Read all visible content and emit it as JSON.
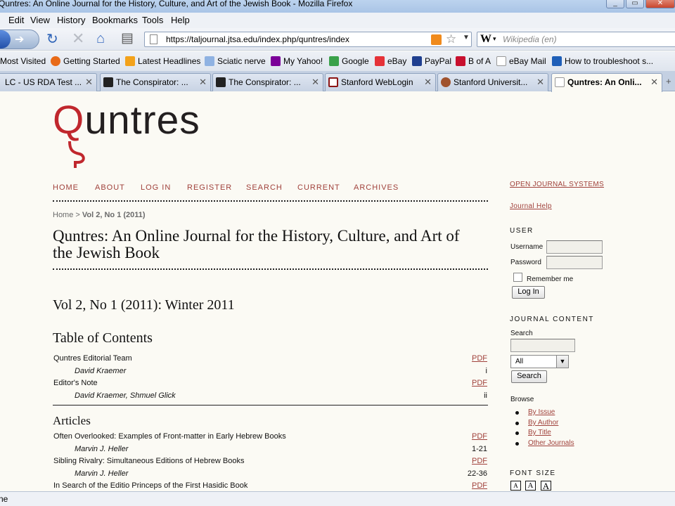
{
  "window": {
    "title": "Quntres: An Online Journal for the History, Culture, and Art of the Jewish Book - Mozilla Firefox"
  },
  "menu": [
    "Edit",
    "View",
    "History",
    "Bookmarks",
    "Tools",
    "Help"
  ],
  "nav": {
    "url": "https://taljournal.jtsa.edu/index.php/quntres/index",
    "search_placeholder": "Wikipedia (en)",
    "search_engine_icon": "W"
  },
  "bookmarks": [
    "Most Visited",
    "Getting Started",
    "Latest Headlines",
    "Sciatic nerve",
    "My Yahoo!",
    "Google",
    "eBay",
    "PayPal",
    "B of A",
    "eBay Mail",
    "How to troubleshoot s..."
  ],
  "tabs": [
    "LC - US RDA Test ...",
    "The Conspirator: ...",
    "The Conspirator: ...",
    "Stanford WebLogin",
    "Stanford Universit...",
    "Quntres: An Onli..."
  ],
  "site": {
    "logo": {
      "q": "Q",
      "rest": "untres"
    },
    "topnav": [
      "HOME",
      "ABOUT",
      "LOG IN",
      "REGISTER",
      "SEARCH",
      "CURRENT",
      "ARCHIVES"
    ],
    "breadcrumb": {
      "home": "Home",
      "sep": ">",
      "current": "Vol 2, No 1 (2011)"
    },
    "journal_title": "Quntres: An Online Journal for the History, Culture, and Art of the Jewish Book",
    "issue_title": "Vol 2, No 1 (2011): Winter 2011",
    "toc_heading": "Table of Contents",
    "articles_heading": "Articles",
    "toc": [
      {
        "title": "Quntres Editorial Team",
        "author": "David Kraemer",
        "link": "PDF",
        "pages": "i"
      },
      {
        "title": "Editor's Note",
        "author": "David Kraemer, Shmuel Glick",
        "link": "PDF",
        "pages": "ii"
      }
    ],
    "articles": [
      {
        "title": "Often Overlooked: Examples of Front-matter in Early Hebrew Books",
        "author": "Marvin J. Heller",
        "link": "PDF",
        "pages": "1-21"
      },
      {
        "title": "Sibling Rivalry: Simultaneous Editions of Hebrew Books",
        "author": "Marvin J. Heller",
        "link": "PDF",
        "pages": "22-36"
      },
      {
        "title": "In Search of the Editio Princeps of the First Hasidic Book",
        "link": "PDF"
      }
    ]
  },
  "sidebar": {
    "ojs_link": "OPEN JOURNAL SYSTEMS",
    "help_link": "Journal Help",
    "user_heading": "USER",
    "username_label": "Username",
    "password_label": "Password",
    "remember_label": "Remember me",
    "login_button": "Log In",
    "journal_content_heading": "JOURNAL CONTENT",
    "search_label": "Search",
    "scope_value": "All",
    "search_button": "Search",
    "browse_label": "Browse",
    "browse_items": [
      "By Issue",
      "By Author",
      "By Title",
      "Other Journals"
    ],
    "font_size_heading": "FONT SIZE",
    "font_sizes": [
      "A",
      "A",
      "A"
    ]
  },
  "status": {
    "text": "ne"
  },
  "colors": {
    "accent": "#a0413b",
    "logo_red": "#c0272d",
    "page_bg": "#fbfaf4"
  }
}
